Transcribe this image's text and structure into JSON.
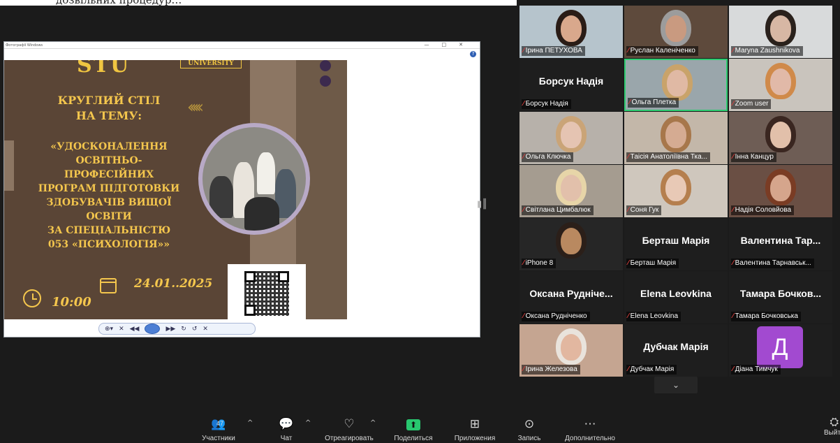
{
  "top_strip_text": "дозвільних процедур…",
  "shared_window": {
    "title": "Фотографії Windows",
    "controls": [
      "—",
      "□",
      "✕"
    ],
    "help": "?"
  },
  "poster": {
    "logo_text": "STU",
    "university": "UNIVERSITY",
    "title_line1": "КРУГЛИЙ СТІЛ",
    "title_line2": "НА ТЕМУ:",
    "body_lines": [
      "«УДОСКОНАЛЕННЯ",
      "ОСВІТНЬО-",
      "ПРОФЕСІЙНИХ",
      "ПРОГРАМ ПІДГОТОВКИ",
      "ЗДОБУВАЧІВ ВИЩОЇ",
      "ОСВІТИ",
      "ЗА СПЕЦІАЛЬНІСТЮ",
      "053 «ПСИХОЛОГІЯ»»"
    ],
    "date": "24.01..2025",
    "time": "10:00"
  },
  "viewer_toolbar": [
    "⊕▾",
    "✕",
    "◀◀",
    "▶▶",
    "↻",
    "↺",
    "✕"
  ],
  "participants": [
    {
      "label": "Ірина ПЕТУХОВА",
      "bg": "#b6c4cc",
      "skin": "#d9a88c",
      "hair": "#2a1c16"
    },
    {
      "label": "Руслан Каленіченко",
      "bg": "#5e4a3c",
      "skin": "#c99a80",
      "hair": "#9c9c9c"
    },
    {
      "label": "Maryna Zaushnikova",
      "bg": "#d8dadb",
      "skin": "#d7b7a4",
      "hair": "#2a211c"
    },
    {
      "label": "Борсук Надія",
      "big": "Борсук Надія"
    },
    {
      "label": "Ольга Плетка",
      "bg": "#9aa6ab",
      "skin": "#e0b9a4",
      "hair": "#c9a36a",
      "active": true
    },
    {
      "label": "Zoom user",
      "bg": "#c9c4bd",
      "skin": "#e1b9a8",
      "hair": "#d08a4a"
    },
    {
      "label": "Ольга Ключка",
      "bg": "#b7b1aa",
      "skin": "#e5c4b2",
      "hair": "#caa477"
    },
    {
      "label": "Таісія Анатоліївна Тка...",
      "bg": "#c3b7a9",
      "skin": "#d5ab92",
      "hair": "#a7774b"
    },
    {
      "label": "Інна Канцур",
      "bg": "#6e5d55",
      "skin": "#e2c0aa",
      "hair": "#3a2620"
    },
    {
      "label": "Світлана Цимбалюк",
      "bg": "#a59c90",
      "skin": "#e2c0ab",
      "hair": "#e7d5a8"
    },
    {
      "label": "Соня Гук",
      "bg": "#cfc7bd",
      "skin": "#e8c9b6",
      "hair": "#b57f4e"
    },
    {
      "label": "Надія Соловйова",
      "bg": "#6a4f44",
      "skin": "#d5a58c",
      "hair": "#7a3c24"
    },
    {
      "label": "iPhone 8",
      "bg": "#262626",
      "skin": "#b98960",
      "hair": "#2b1f19"
    },
    {
      "label": "Берташ Марія",
      "big": "Берташ Марія"
    },
    {
      "label": "Валентина Тарнавськ...",
      "big": "Валентина Тар..."
    },
    {
      "label": "Оксана Рудніченко",
      "big": "Оксана Рудніче..."
    },
    {
      "label": "Elena Leovkina",
      "big": "Elena Leovkina"
    },
    {
      "label": "Тамара Бочковська",
      "big": "Тамара Бочков..."
    },
    {
      "label": "Ірина Железова",
      "bg": "#c5a591",
      "skin": "#e2b7a0",
      "hair": "#e9e3dc"
    },
    {
      "label": "Дубчак Марія",
      "big": "Дубчак Марія"
    },
    {
      "label": "Діана Тимчук",
      "avatar": "Д"
    }
  ],
  "toolbar": {
    "participants_label": "Участники",
    "participants_count": "47",
    "chat_label": "Чат",
    "react_label": "Отреагировать",
    "share_label": "Поделиться",
    "apps_label": "Приложения",
    "record_label": "Запись",
    "more_label": "Дополнительно",
    "leave_label": "Выйти"
  },
  "colors": {
    "accent_green": "#28c76f",
    "active_border": "#2ecc71",
    "mic_muted": "#e0413f",
    "avatar_purple": "#a24ad0",
    "poster_gold": "#f4c64d"
  }
}
